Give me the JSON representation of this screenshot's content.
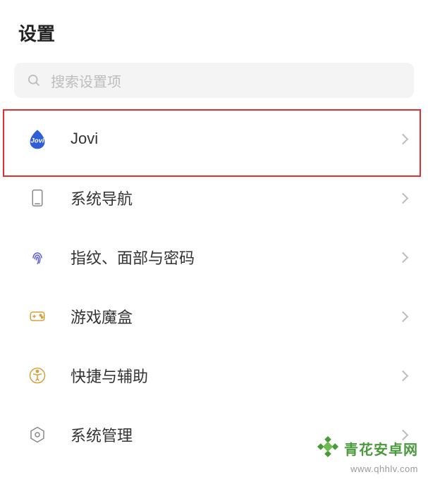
{
  "header": {
    "title": "设置"
  },
  "search": {
    "placeholder": "搜索设置项"
  },
  "items": [
    {
      "id": "jovi",
      "label": "Jovi",
      "icon_text": "Jovi"
    },
    {
      "id": "system-navigation",
      "label": "系统导航"
    },
    {
      "id": "fingerprint-face-password",
      "label": "指纹、面部与密码"
    },
    {
      "id": "game-box",
      "label": "游戏魔盒"
    },
    {
      "id": "shortcut-accessibility",
      "label": "快捷与辅助"
    },
    {
      "id": "system-management",
      "label": "系统管理"
    }
  ],
  "watermark": {
    "brand": "青花安卓网",
    "url": "www.qhhlv.com"
  },
  "highlight": {
    "target": "jovi"
  }
}
